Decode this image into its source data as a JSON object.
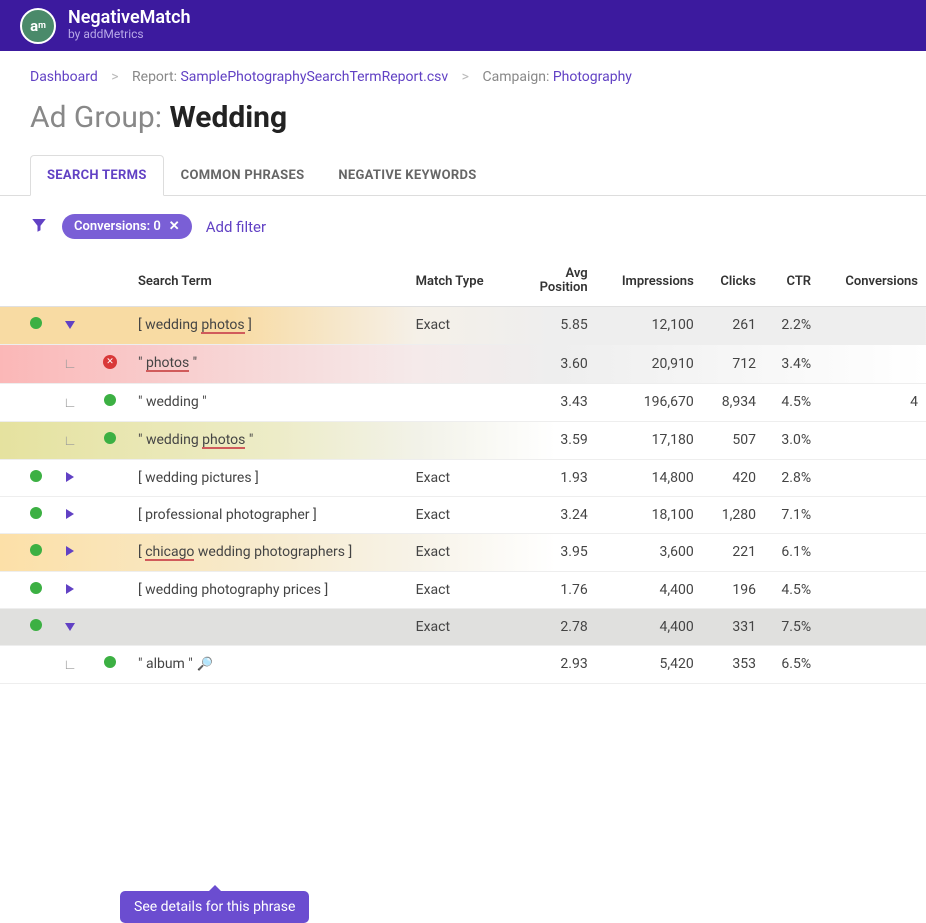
{
  "header": {
    "logo_text": "a",
    "logo_sup": "m",
    "title": "NegativeMatch",
    "subtitle": "by addMetrics"
  },
  "breadcrumb": {
    "dashboard": "Dashboard",
    "report_prefix": "Report: ",
    "report_name": "SamplePhotographySearchTermReport.csv",
    "campaign_prefix": "Campaign: ",
    "campaign_name": "Photography"
  },
  "page_title": {
    "prefix": "Ad Group: ",
    "entity": "Wedding"
  },
  "tabs": {
    "search_terms": "SEARCH TERMS",
    "common_phrases": "COMMON PHRASES",
    "negative_keywords": "NEGATIVE KEYWORDS"
  },
  "filters": {
    "pill_label": "Conversions: 0",
    "add_label": "Add filter"
  },
  "tooltip": "See details for this phrase",
  "table": {
    "headers": {
      "search_term": "Search Term",
      "match_type": "Match Type",
      "avg_position": "Avg Position",
      "impressions": "Impressions",
      "clicks": "Clicks",
      "ctr": "CTR",
      "conversions": "Conversions"
    },
    "rows": [
      {
        "level": 0,
        "expanded": true,
        "status": "green",
        "term_pre": "[ wedding ",
        "term_u": "photos",
        "term_post": " ]",
        "match": "Exact",
        "avg": "5.85",
        "imp": "12,100",
        "clicks": "261",
        "ctr": "2.2%",
        "conv": "",
        "cls": "row-orange"
      },
      {
        "level": 1,
        "status": "red",
        "term_pre": "\" ",
        "term_u": "photos",
        "term_post": " \"",
        "match": "",
        "avg": "3.60",
        "imp": "20,910",
        "clicks": "712",
        "ctr": "3.4%",
        "conv": "",
        "cls": "row-red"
      },
      {
        "level": 1,
        "status": "green",
        "term_pre": "\" wedding \"",
        "term_u": "",
        "term_post": "",
        "match": "",
        "avg": "3.43",
        "imp": "196,670",
        "clicks": "8,934",
        "ctr": "4.5%",
        "conv": "4",
        "cls": ""
      },
      {
        "level": 1,
        "status": "green",
        "term_pre": "\" wedding ",
        "term_u": "photos",
        "term_post": " \"",
        "match": "",
        "avg": "3.59",
        "imp": "17,180",
        "clicks": "507",
        "ctr": "3.0%",
        "conv": "",
        "cls": "row-lgrn"
      },
      {
        "level": 0,
        "expanded": false,
        "status": "green",
        "term_pre": "[ wedding pictures ]",
        "term_u": "",
        "term_post": "",
        "match": "Exact",
        "avg": "1.93",
        "imp": "14,800",
        "clicks": "420",
        "ctr": "2.8%",
        "conv": "",
        "cls": ""
      },
      {
        "level": 0,
        "expanded": false,
        "status": "green",
        "term_pre": "[ professional photographer ]",
        "term_u": "",
        "term_post": "",
        "match": "Exact",
        "avg": "3.24",
        "imp": "18,100",
        "clicks": "1,280",
        "ctr": "7.1%",
        "conv": "",
        "cls": ""
      },
      {
        "level": 0,
        "expanded": false,
        "status": "green",
        "term_pre": "[ ",
        "term_u": "chicago",
        "term_post": " wedding photographers ]",
        "match": "Exact",
        "avg": "3.95",
        "imp": "3,600",
        "clicks": "221",
        "ctr": "6.1%",
        "conv": "",
        "cls": "row-orange2"
      },
      {
        "level": 0,
        "expanded": false,
        "status": "green",
        "term_pre": "[ wedding photography prices ]",
        "term_u": "",
        "term_post": "",
        "match": "Exact",
        "avg": "1.76",
        "imp": "4,400",
        "clicks": "196",
        "ctr": "4.5%",
        "conv": "",
        "cls": ""
      },
      {
        "level": 0,
        "expanded": true,
        "status": "green",
        "term_pre": "",
        "term_u": "",
        "term_post": "",
        "match": "Exact",
        "avg": "2.78",
        "imp": "4,400",
        "clicks": "331",
        "ctr": "7.5%",
        "conv": "",
        "cls": "row-grey"
      },
      {
        "level": 1,
        "status": "green",
        "term_pre": "\" album \"",
        "term_u": "",
        "term_post": "",
        "mag": true,
        "match": "",
        "avg": "2.93",
        "imp": "5,420",
        "clicks": "353",
        "ctr": "6.5%",
        "conv": "",
        "cls": ""
      }
    ]
  }
}
